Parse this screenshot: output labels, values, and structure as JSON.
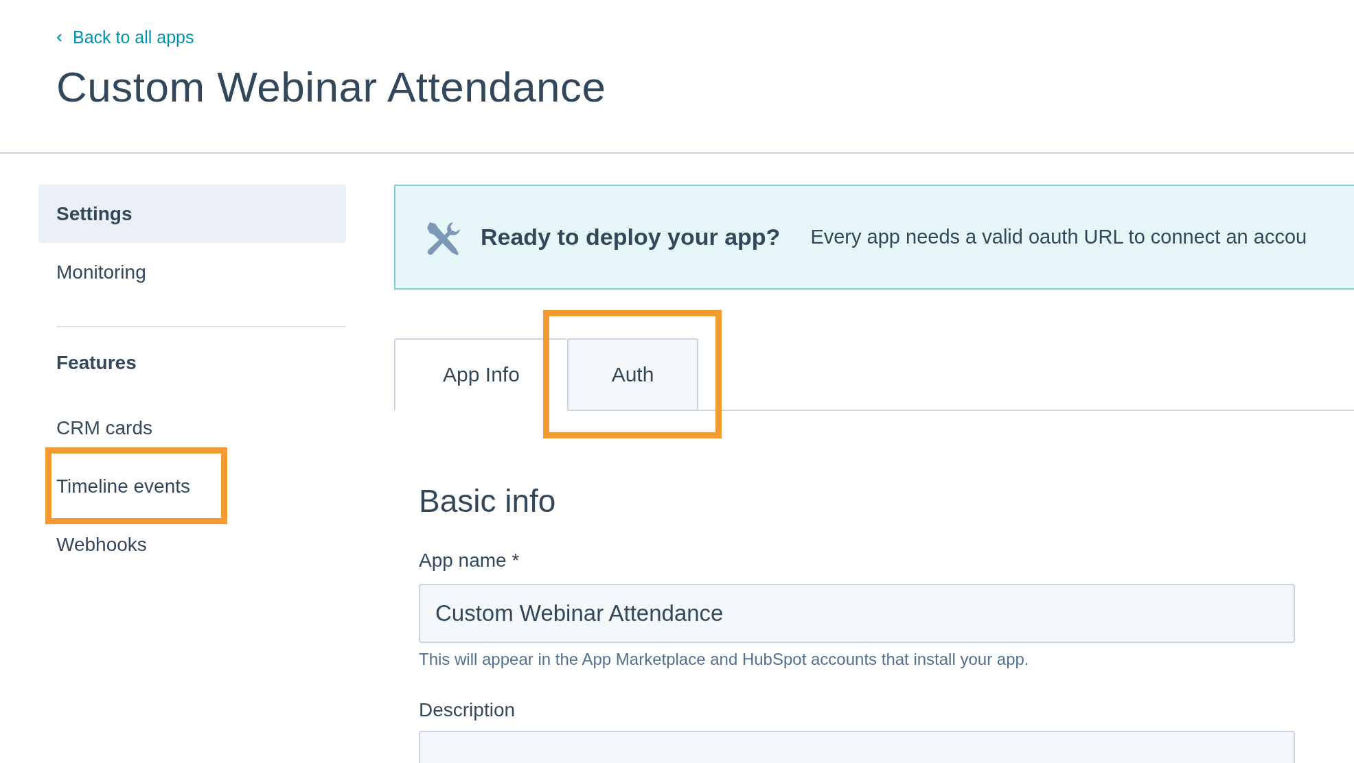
{
  "header": {
    "back_link": "Back to all apps",
    "title": "Custom Webinar Attendance"
  },
  "sidebar": {
    "groups": [
      {
        "items": [
          {
            "label": "Settings",
            "selected": true,
            "highlighted": false
          },
          {
            "label": "Monitoring",
            "selected": false,
            "highlighted": false
          }
        ]
      },
      {
        "heading": "Features",
        "items": [
          {
            "label": "CRM cards",
            "selected": false,
            "highlighted": false
          },
          {
            "label": "Timeline events",
            "selected": false,
            "highlighted": true
          },
          {
            "label": "Webhooks",
            "selected": false,
            "highlighted": false
          }
        ]
      }
    ]
  },
  "banner": {
    "title": "Ready to deploy your app?",
    "text": "Every app needs a valid oauth URL to connect an accou"
  },
  "tabs": [
    {
      "label": "App Info",
      "selected": true,
      "highlighted": false
    },
    {
      "label": "Auth",
      "selected": false,
      "highlighted": true
    }
  ],
  "form": {
    "heading": "Basic info",
    "fields": [
      {
        "label": "App name *",
        "value": "Custom Webinar Attendance",
        "help": "This will appear in the App Marketplace and HubSpot accounts that install your app."
      },
      {
        "label": "Description"
      }
    ]
  }
}
